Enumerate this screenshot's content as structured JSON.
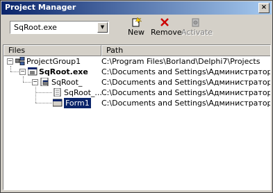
{
  "window": {
    "title": "Project Manager",
    "close_glyph": "×"
  },
  "toolbar": {
    "combo_value": "SqRoot.exe",
    "new_label": "New",
    "remove_label": "Remove",
    "activate_label": "Activate"
  },
  "columns": {
    "files": "Files",
    "path": "Path"
  },
  "rows": [
    {
      "name": "ProjectGroup1",
      "path": "C:\\Program Files\\Borland\\Delphi7\\Projects"
    },
    {
      "name": "SqRoot.exe",
      "path": "C:\\Documents and Settings\\Администратор\\Рабочий ст"
    },
    {
      "name": "SqRoot_",
      "path": "C:\\Documents and Settings\\Администратор\\Рабочий ст"
    },
    {
      "name": "SqRoot_...",
      "path": "C:\\Documents and Settings\\Администратор\\Рабочий ст"
    },
    {
      "name": "Form1",
      "path": "C:\\Documents and Settings\\Администратор\\Рабочий ст"
    }
  ],
  "colors": {
    "title_start": "#0a246a",
    "title_end": "#a6caf0",
    "selection": "#0a246a",
    "remove_red": "#cc0000"
  }
}
